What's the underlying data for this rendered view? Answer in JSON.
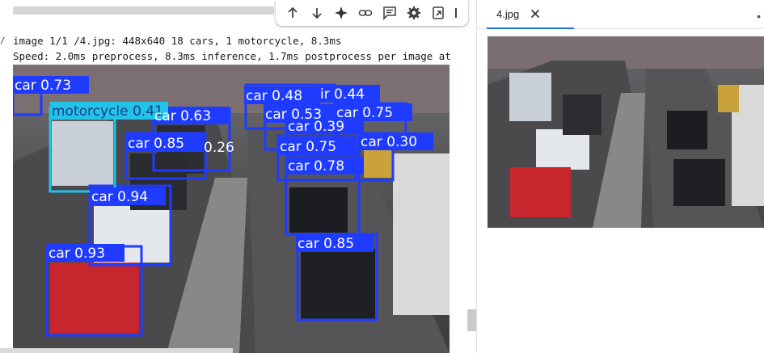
{
  "output": {
    "left_mark": "/",
    "line1": "image 1/1 /4.jpg: 448x640 18 cars, 1 motorcycle, 8.3ms",
    "line2": "Speed: 2.0ms preprocess, 8.3ms inference, 1.7ms postprocess per image at"
  },
  "toolbar": {
    "buttons": [
      "arrow-up-icon",
      "arrow-down-icon",
      "sparkle-icon",
      "link-icon",
      "comment-icon",
      "gear-icon",
      "open-in-tab-icon",
      "more-icon"
    ]
  },
  "detections": [
    {
      "label": "car 0.73"
    },
    {
      "label": "motorcycle 0.41"
    },
    {
      "label": "car 0.63"
    },
    {
      "label": "car 0.85"
    },
    {
      "label": "0.26"
    },
    {
      "label": "car 0.94"
    },
    {
      "label": "car 0.93"
    },
    {
      "label": "car 0.48"
    },
    {
      "label": "ir 0.44"
    },
    {
      "label": "car 0.53"
    },
    {
      "label": "car 0.75"
    },
    {
      "label": "car 0.39"
    },
    {
      "label": "car 0.75"
    },
    {
      "label": "car 0.30"
    },
    {
      "label": "car 0.78"
    },
    {
      "label": "car 0.85"
    }
  ],
  "colors": {
    "box_blue": "#1f3bff",
    "box_cyan": "#22c3e6",
    "tab_accent": "#1a73e8"
  },
  "preview": {
    "tab_label": "4.jpg",
    "more": "•"
  }
}
